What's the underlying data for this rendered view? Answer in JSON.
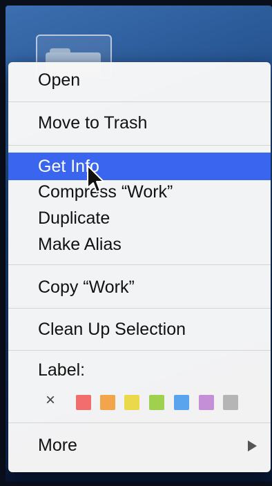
{
  "menu": {
    "items": [
      {
        "label": "Open"
      },
      {
        "label": "Move to Trash"
      },
      {
        "label": "Get Info"
      },
      {
        "label": "Compress “Work”"
      },
      {
        "label": "Duplicate"
      },
      {
        "label": "Make Alias"
      },
      {
        "label": "Copy “Work”"
      },
      {
        "label": "Clean Up Selection"
      }
    ],
    "label_title": "Label:",
    "none_label_glyph": "×",
    "label_colors": [
      {
        "name": "red",
        "color": "#f26d6d"
      },
      {
        "name": "orange",
        "color": "#f3a54b"
      },
      {
        "name": "yellow",
        "color": "#ead94a"
      },
      {
        "name": "green",
        "color": "#9fd14f"
      },
      {
        "name": "blue",
        "color": "#5aa4ee"
      },
      {
        "name": "purple",
        "color": "#c48fd6"
      },
      {
        "name": "gray",
        "color": "#b5b5b5"
      }
    ],
    "more_label": "More",
    "highlight_color": "#3a66ef"
  },
  "icons": {
    "folder": "folder-icon",
    "submenu_arrow": "submenu-arrow-icon",
    "cursor": "mouse-pointer-icon"
  }
}
